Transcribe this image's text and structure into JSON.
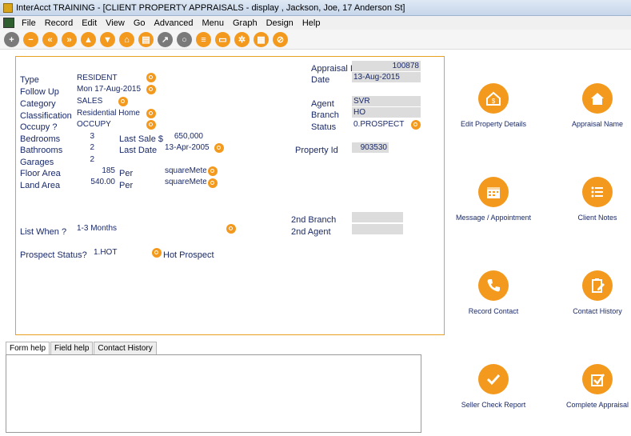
{
  "window": {
    "title": "InterAcct TRAINING - [CLIENT PROPERTY APPRAISALS - display , Jackson, Joe, 17 Anderson St]"
  },
  "menu": [
    "File",
    "Record",
    "Edit",
    "View",
    "Go",
    "Advanced",
    "Menu",
    "Graph",
    "Design",
    "Help"
  ],
  "toolbar": [
    {
      "name": "add",
      "glyph": "+",
      "color": "grey"
    },
    {
      "name": "remove",
      "glyph": "−",
      "color": "orange"
    },
    {
      "name": "first",
      "glyph": "«",
      "color": "orange"
    },
    {
      "name": "last",
      "glyph": "»",
      "color": "orange"
    },
    {
      "name": "up",
      "glyph": "▲",
      "color": "orange"
    },
    {
      "name": "down",
      "glyph": "▼",
      "color": "orange"
    },
    {
      "name": "home",
      "glyph": "⌂",
      "color": "orange"
    },
    {
      "name": "print",
      "glyph": "▤",
      "color": "orange"
    },
    {
      "name": "export",
      "glyph": "↗",
      "color": "grey"
    },
    {
      "name": "search",
      "glyph": "○",
      "color": "grey"
    },
    {
      "name": "list",
      "glyph": "≡",
      "color": "orange"
    },
    {
      "name": "screen",
      "glyph": "▭",
      "color": "orange"
    },
    {
      "name": "settings",
      "glyph": "✲",
      "color": "orange"
    },
    {
      "name": "calendar",
      "glyph": "▦",
      "color": "orange"
    },
    {
      "name": "cancel",
      "glyph": "⊘",
      "color": "orange"
    }
  ],
  "form": {
    "type_label": "Type",
    "type_value": "RESIDENT",
    "followup_label": "Follow Up",
    "followup_value": "Mon 17-Aug-2015",
    "category_label": "Category",
    "category_value": "SALES",
    "classification_label": "Classification",
    "classification_value": "Residential Home",
    "occupy_label": "Occupy ?",
    "occupy_value": "OCCUPY",
    "bedrooms_label": "Bedrooms",
    "bedrooms_value": "3",
    "bathrooms_label": "Bathrooms",
    "bathrooms_value": "2",
    "garages_label": "Garages",
    "garages_value": "2",
    "floorarea_label": "Floor Area",
    "floorarea_value": "185",
    "landarea_label": "Land Area",
    "landarea_value": "540.00",
    "per_label": "Per",
    "floor_per_value": "squareMeter",
    "land_per_value": "squareMeter",
    "lastsale_label": "Last Sale $",
    "lastsale_value": "650,000",
    "lastdate_label": "Last Date",
    "lastdate_value": "13-Apr-2005",
    "appraisalid_label": "Appraisal Id",
    "appraisalid_value": "100878",
    "date_label": "Date",
    "date_value": "13-Aug-2015",
    "agent_label": "Agent",
    "agent_value": "SVR",
    "branch_label": "Branch",
    "branch_value": "HO",
    "status_label": "Status",
    "status_value": "0.PROSPECT",
    "propertyid_label": "Property Id",
    "propertyid_value": "903530",
    "branch2_label": "2nd Branch",
    "branch2_value": "",
    "agent2_label": "2nd Agent",
    "agent2_value": "",
    "listwhen_label": "List When ?",
    "listwhen_value": "1-3 Months",
    "prospectstatus_label": "Prospect Status?",
    "prospectstatus_value": "1.HOT",
    "prospectstatus_desc": "Hot Prospect"
  },
  "tabs": [
    "Form help",
    "Field help",
    "Contact History"
  ],
  "actions": {
    "edit_property": "Edit Property Details",
    "appraisal_name": "Appraisal Name",
    "message": "Message / Appointment",
    "client_notes": "Client Notes",
    "record_contact": "Record Contact",
    "contact_history": "Contact History",
    "seller_check": "Seller Check Report",
    "complete_appraisal": "Complete Appraisal"
  },
  "colors": {
    "accent": "#f39a1e",
    "text": "#1a2a6a",
    "field_grey": "#dcdcdc",
    "frame": "#e8a020"
  }
}
